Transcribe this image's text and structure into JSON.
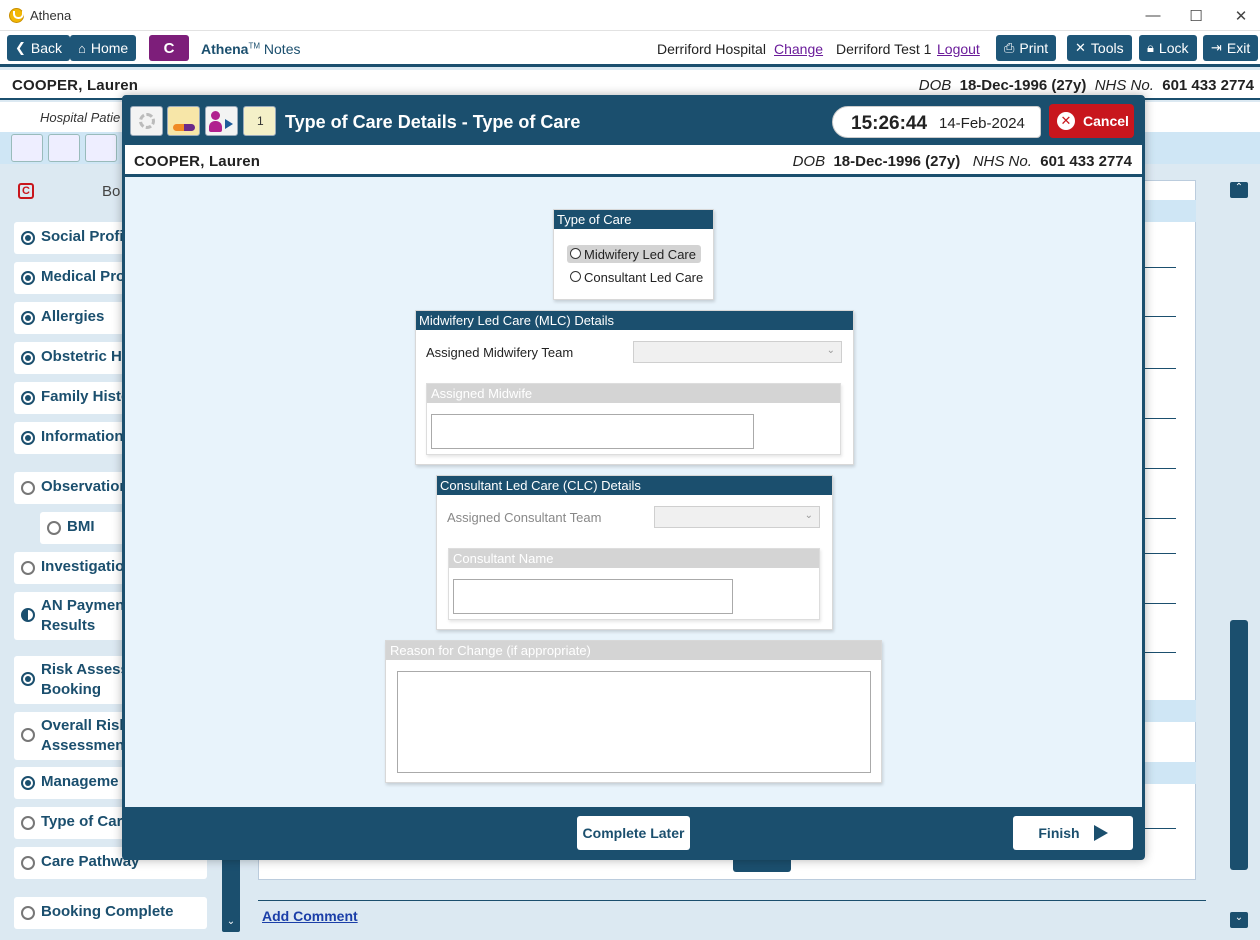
{
  "window": {
    "title": "Athena",
    "minimize": "—",
    "maximize": "☐",
    "close": "✕"
  },
  "toolbar": {
    "back": "Back",
    "home": "Home",
    "c_label": "C",
    "brand_name": "Athena",
    "brand_tm": "TM",
    "brand_suffix": "Notes",
    "hospital": "Derriford Hospital",
    "change": "Change",
    "user": "Derriford Test 1",
    "logout": "Logout",
    "print": "Print",
    "tools": "Tools",
    "lock": "Lock",
    "exit": "Exit"
  },
  "patient": {
    "name": "COOPER, Lauren",
    "dob_label": "DOB",
    "dob": "18-Dec-1996 (27y)",
    "nhs_label": "NHS No.",
    "nhs": "601 433 2774"
  },
  "subbar": {
    "hospital_partial": "Hospital Patie"
  },
  "sidebar": {
    "header_c": "C",
    "header_partial": "Bo",
    "items": [
      {
        "label": "Social Profil",
        "state": "filled"
      },
      {
        "label": "Medical Pro",
        "state": "filled"
      },
      {
        "label": "Allergies",
        "state": "filled"
      },
      {
        "label": "Obstetric H",
        "state": "filled"
      },
      {
        "label": "Family Histo",
        "state": "filled"
      },
      {
        "label": "Information",
        "state": "filled"
      },
      {
        "label": "Observation",
        "state": "empty"
      },
      {
        "label": "BMI",
        "state": "empty"
      },
      {
        "label": "Investigatio",
        "state": "empty"
      },
      {
        "label": "AN Paymen",
        "label2": "Results",
        "state": "half"
      },
      {
        "label": "Risk Assess",
        "label2": "Booking",
        "state": "filled"
      },
      {
        "label": "Overall Risk",
        "label2": "Assessment",
        "state": "empty"
      },
      {
        "label": "Manageme",
        "state": "filled"
      },
      {
        "label": "Type of Car",
        "state": "empty"
      },
      {
        "label": "Care Pathway",
        "state": "empty"
      },
      {
        "label": "Booking Complete",
        "state": "empty"
      }
    ]
  },
  "content": {
    "add_comment": "Add Comment"
  },
  "modal": {
    "title": "Type of Care Details - Type of Care",
    "time": "15:26:44",
    "date": "14-Feb-2024",
    "cancel": "Cancel",
    "type_of_care": {
      "heading": "Type of Care",
      "options": [
        "Midwifery Led Care",
        "Consultant Led Care"
      ],
      "highlighted": "Midwifery Led Care"
    },
    "mlc": {
      "heading": "Midwifery Led Care (MLC) Details",
      "team_label": "Assigned Midwifery Team",
      "team_value": "",
      "midwife_heading": "Assigned Midwife",
      "midwife_value": ""
    },
    "clc": {
      "heading": "Consultant Led Care (CLC) Details",
      "team_label": "Assigned Consultant Team",
      "team_value": "",
      "name_heading": "Consultant Name",
      "name_value": ""
    },
    "reason": {
      "heading": "Reason for Change (if appropriate)",
      "value": ""
    },
    "complete_later": "Complete Later",
    "finish": "Finish"
  },
  "colors": {
    "primary": "#1b4f6e",
    "cancel": "#c8161d",
    "c_button": "#7d1e7a",
    "background": "#dce9f2"
  }
}
